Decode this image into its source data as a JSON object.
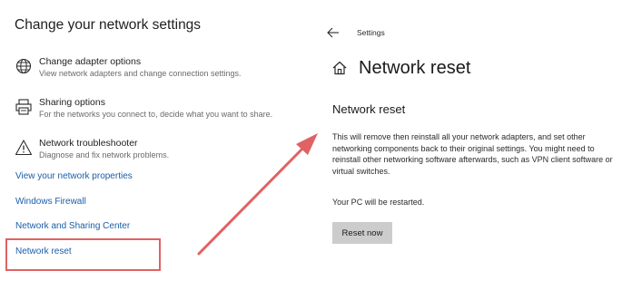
{
  "left_panel": {
    "title": "Change your network settings",
    "options": [
      {
        "icon": "adapter-icon",
        "title": "Change adapter options",
        "description": "View network adapters and change connection settings."
      },
      {
        "icon": "printer-icon",
        "title": "Sharing options",
        "description": "For the networks you connect to, decide what you want to share."
      },
      {
        "icon": "warning-icon",
        "title": "Network troubleshooter",
        "description": "Diagnose and fix network problems."
      }
    ],
    "links": [
      "View your network properties",
      "Windows Firewall",
      "Network and Sharing Center",
      "Network reset"
    ]
  },
  "annotation": {
    "highlight_color": "#e06262",
    "arrow_color": "#e06262"
  },
  "right_panel": {
    "breadcrumb": "Settings",
    "page_title": "Network reset",
    "section_title": "Network reset",
    "description": "This will remove then reinstall all your network adapters, and set other networking components back to their original settings. You might need to reinstall other networking software afterwards, such as VPN client software or virtual switches.",
    "restart_notice": "Your PC will be restarted.",
    "reset_button_label": "Reset now"
  },
  "colors": {
    "link": "#1a5ea8",
    "button_bg": "#cccccc"
  }
}
